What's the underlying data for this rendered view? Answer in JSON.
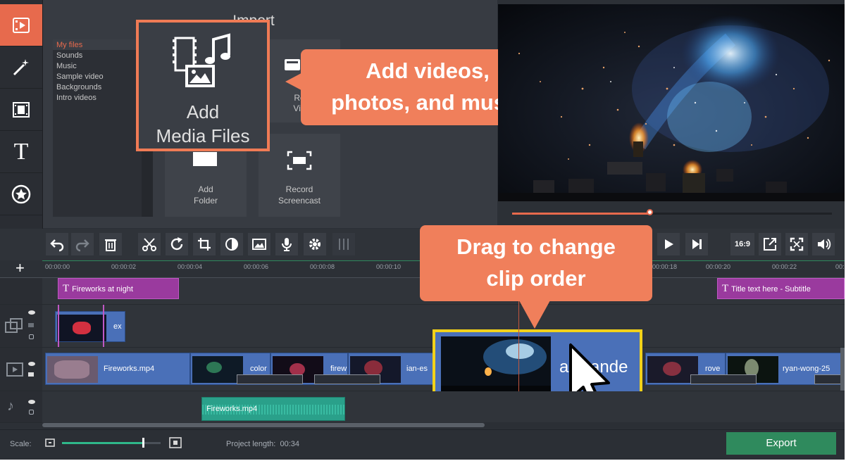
{
  "colors": {
    "accent": "#e76a4d",
    "callout": "#f07f5b",
    "export": "#2f8a5d",
    "title_clip": "#9a3a9e",
    "video_clip": "#4a70b8",
    "audio_clip": "#2aa08a"
  },
  "sidebar": {
    "items": [
      {
        "icon": "import-film-icon",
        "active": true
      },
      {
        "icon": "magic-wand-icon"
      },
      {
        "icon": "transitions-icon"
      },
      {
        "icon": "titles-icon",
        "glyph": "T"
      },
      {
        "icon": "stickers-icon"
      },
      {
        "icon": "menu-lines-icon"
      }
    ]
  },
  "import": {
    "title": "Import",
    "files": [
      "My files",
      "Sounds",
      "Music",
      "Sample video",
      "Backgrounds",
      "Intro videos"
    ],
    "selected_file": "My files",
    "add_media": {
      "line1": "Add",
      "line2": "Media Files"
    },
    "record_video_partial": {
      "line1": "Re",
      "line2": "Vid"
    },
    "add_folder": {
      "line1": "Add",
      "line2": "Folder"
    },
    "record_screencast": {
      "line1": "Record",
      "line2": "Screencast"
    }
  },
  "callouts": {
    "add": {
      "line1": "Add videos,",
      "line2": "photos, and music"
    },
    "drag": {
      "line1": "Drag to change",
      "line2": "clip order"
    }
  },
  "player": {
    "progress_fraction": 0.43
  },
  "toolbar": {
    "left_tools": [
      "undo-icon",
      "redo-icon",
      "delete-icon",
      "cut-icon",
      "rotate-icon",
      "crop-icon",
      "color-adjust-icon",
      "image-icon",
      "microphone-icon",
      "settings-icon",
      "equalizer-icon"
    ],
    "aspect_ratio": "16:9",
    "right_tools": [
      "play-icon",
      "next-icon",
      "aspect-ratio-icon",
      "popout-icon",
      "fullscreen-icon",
      "volume-icon"
    ]
  },
  "timeline": {
    "add_symbol": "+",
    "ticks": [
      "00:00:00",
      "00:00:02",
      "00:00:04",
      "00:00:06",
      "00:00:08",
      "00:00:10",
      "00:00:18",
      "00:00:20",
      "00:00:22",
      "00:"
    ],
    "title_clips": [
      "Fireworks at night",
      "Title text here - Subtitle"
    ],
    "overlay_clip": "ex",
    "video_clips": [
      "Fireworks.mp4",
      "color",
      "firew",
      "ian-es",
      "alexande",
      "rove",
      "ryan-wong-25"
    ],
    "audio_clip": "Fireworks.mp4"
  },
  "bottom": {
    "scale_label": "Scale:",
    "scale_fraction": 0.82,
    "project_length_label": "Project length:",
    "project_length": "00:34",
    "export_label": "Export"
  }
}
